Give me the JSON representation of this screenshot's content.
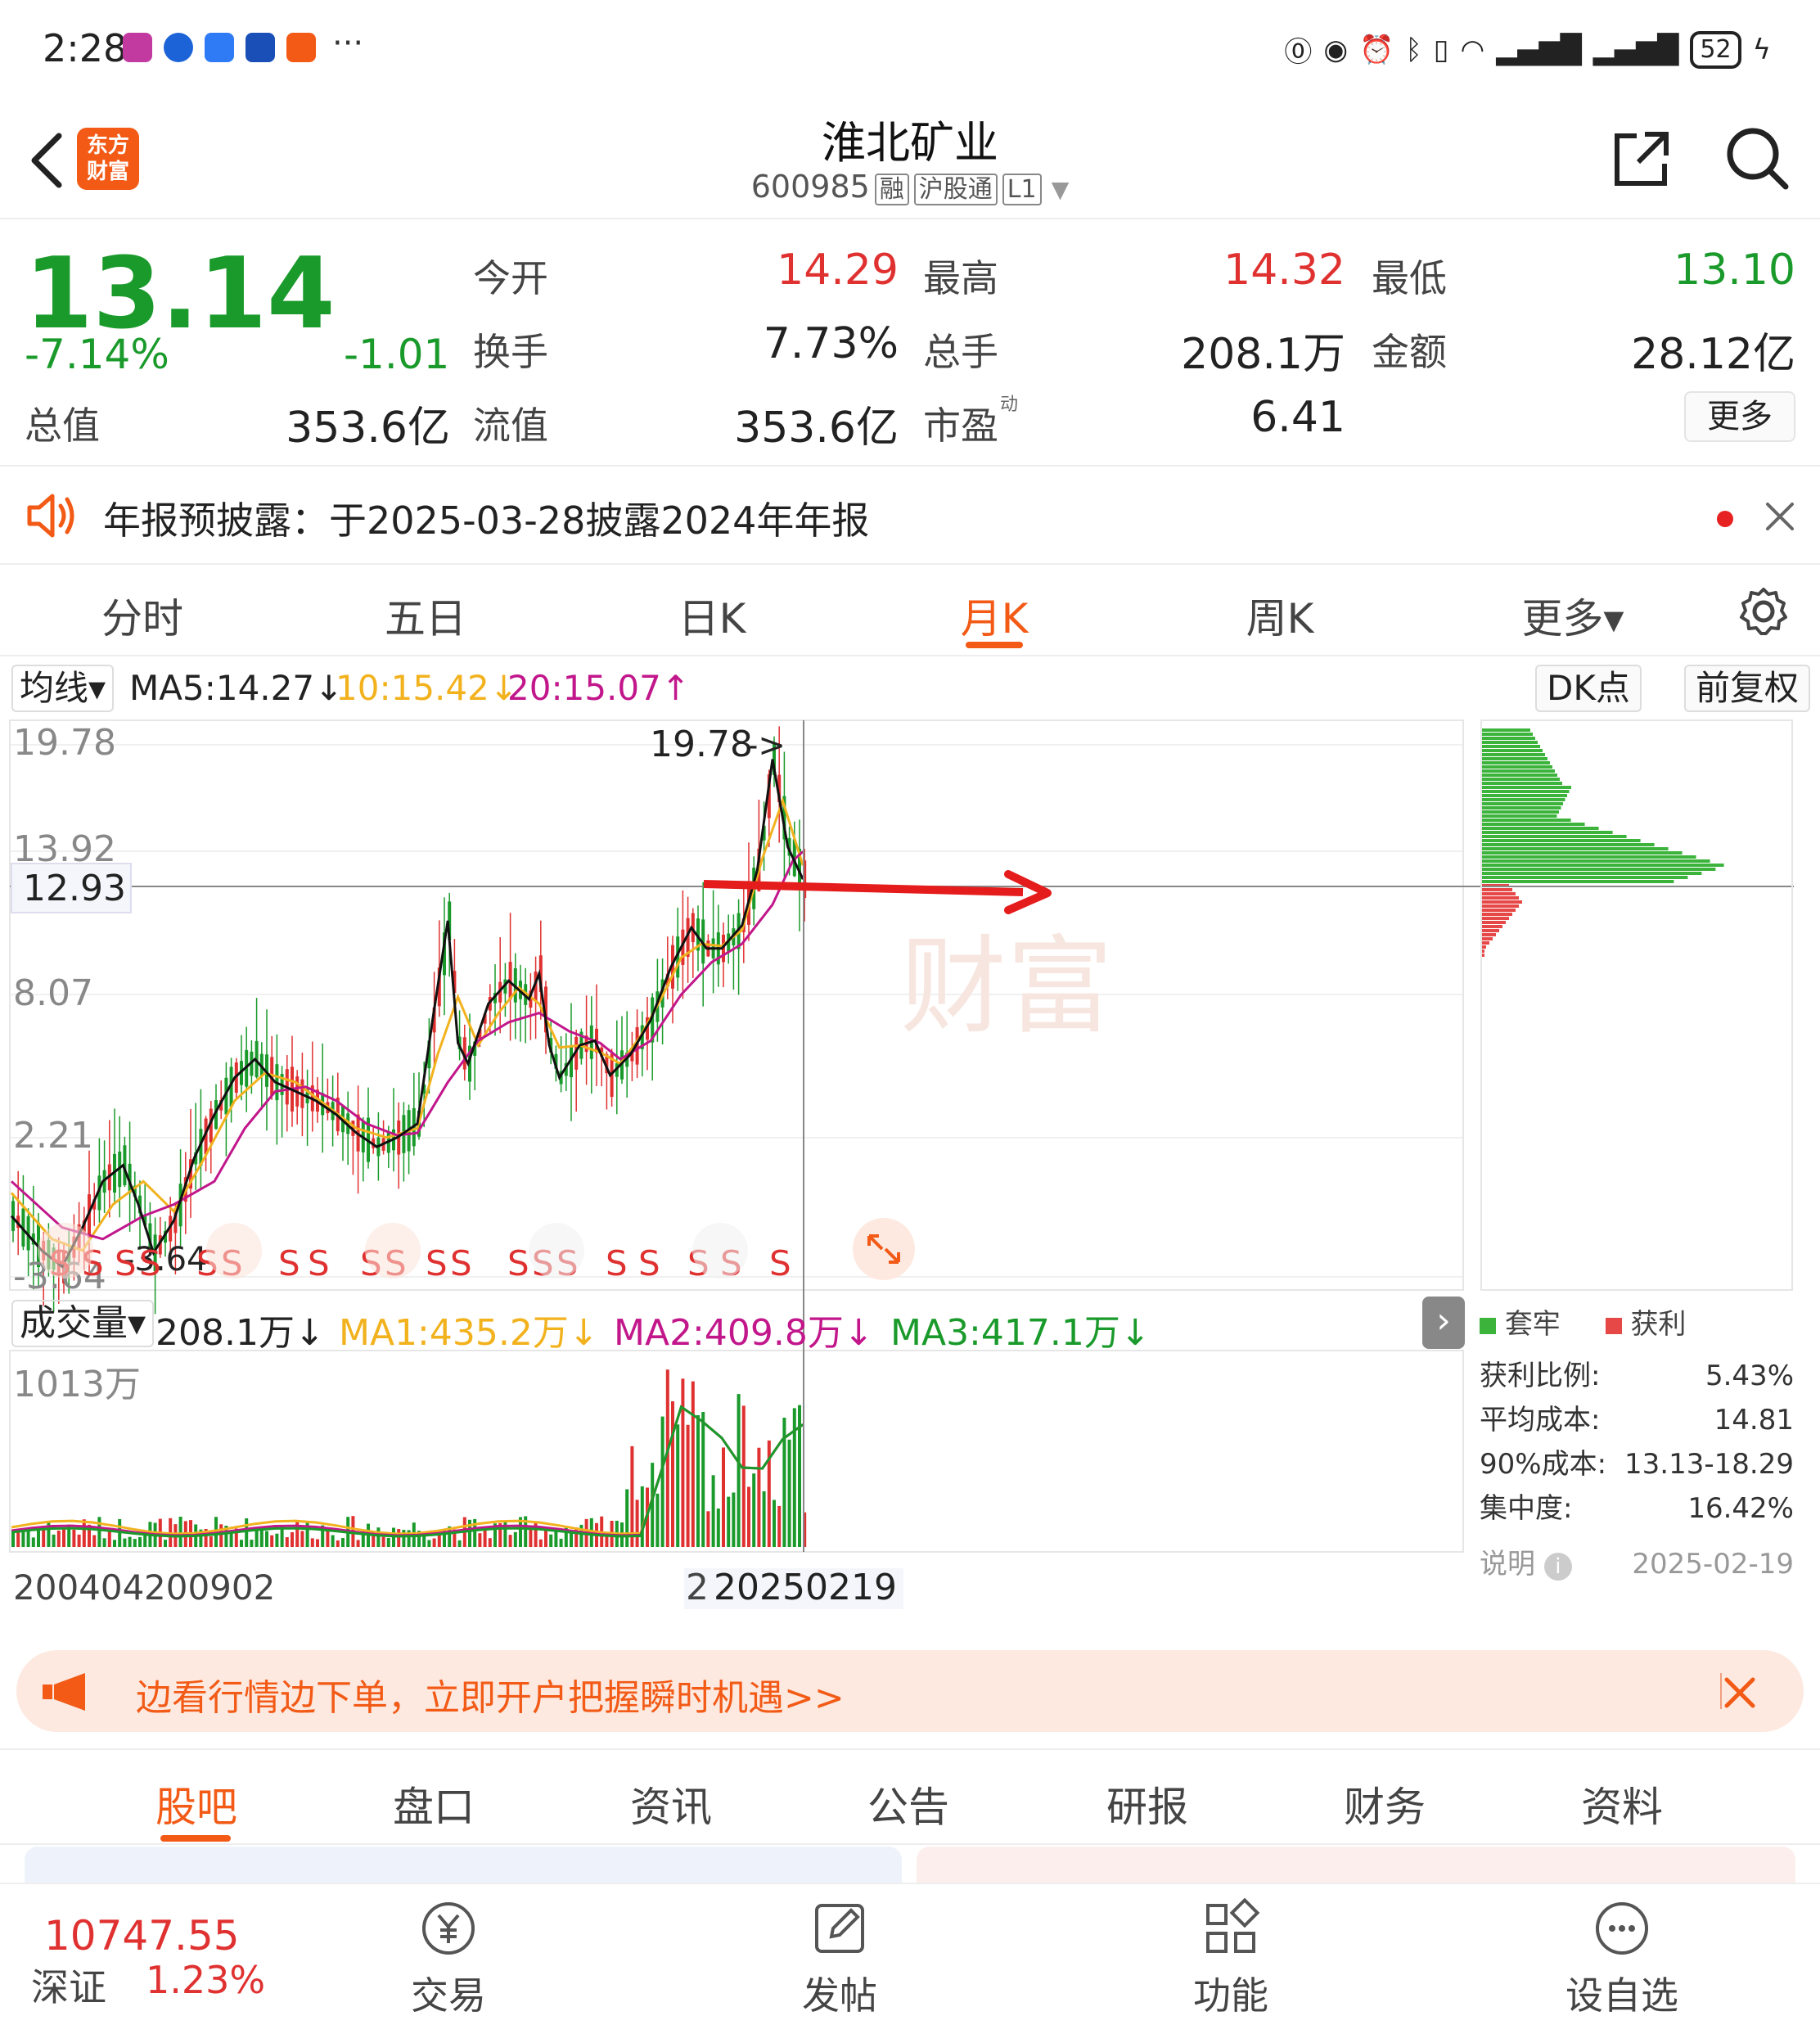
{
  "status_bar": {
    "time": "2:28",
    "more": "···",
    "battery": "52"
  },
  "header": {
    "logo_line1": "东方",
    "logo_line2": "财富",
    "title": "淮北矿业",
    "code": "600985",
    "tags": [
      "融",
      "沪股通",
      "L1"
    ]
  },
  "quote": {
    "price": "13.14",
    "change_pct": "-7.14%",
    "change_amt": "-1.01",
    "rows": [
      {
        "l1": "今开",
        "v1": "14.29",
        "l2": "最高",
        "v2": "14.32",
        "l3": "最低",
        "v3": "13.10"
      },
      {
        "l1": "换手",
        "v1": "7.73%",
        "l2": "总手",
        "v2": "208.1万",
        "l3": "金额",
        "v3": "28.12亿"
      }
    ],
    "zongzhi_label": "总值",
    "zongzhi_value": "353.6亿",
    "liuzhi_label": "流值",
    "liuzhi_value": "353.6亿",
    "pe_label": "市盈",
    "pe_super": "动",
    "pe_value": "6.41",
    "more_button": "更多"
  },
  "notice": {
    "text": "年报预披露：于2025-03-28披露2024年年报"
  },
  "chart_tabs": {
    "items": [
      "分时",
      "五日",
      "日K",
      "月K",
      "周K",
      "更多▾"
    ],
    "active_index": 3
  },
  "ma_row": {
    "dropdown": "均线▾",
    "ma5": "MA5:14.27↓",
    "ma10": "10:15.42↓",
    "ma20": "20:15.07↑",
    "dk_button": "DK点",
    "fq_button": "前复权"
  },
  "colors": {
    "up": "#e03131",
    "down": "#1a9a2b",
    "accent": "#f25a16",
    "ma5": "#111111",
    "ma10": "#f2b21e",
    "ma20": "#c2168b"
  },
  "chart_data": {
    "type": "candlestick",
    "y_axis_labels": [
      "19.78",
      "13.92",
      "8.07",
      "2.21",
      "-3.64"
    ],
    "crosshair_value": "12.93",
    "high_label": "19.78",
    "low_label": "-3.64",
    "signal_label": "S",
    "ylim": [
      -3.64,
      19.78
    ],
    "ma5_path": [
      [
        0,
        -1.0
      ],
      [
        6,
        -2.5
      ],
      [
        10,
        -3.2
      ],
      [
        14,
        -1.5
      ],
      [
        18,
        0.5
      ],
      [
        22,
        1.2
      ],
      [
        25,
        -0.5
      ],
      [
        28,
        -2.6
      ],
      [
        32,
        -1.2
      ],
      [
        36,
        1.5
      ],
      [
        40,
        3.4
      ],
      [
        44,
        5.0
      ],
      [
        48,
        5.8
      ],
      [
        52,
        4.8
      ],
      [
        56,
        4.4
      ],
      [
        60,
        4.0
      ],
      [
        64,
        3.4
      ],
      [
        68,
        2.6
      ],
      [
        72,
        2.0
      ],
      [
        76,
        2.4
      ],
      [
        80,
        3.0
      ],
      [
        83,
        7.5
      ],
      [
        86,
        11.8
      ],
      [
        88,
        6.5
      ],
      [
        90,
        5.6
      ],
      [
        94,
        8.2
      ],
      [
        98,
        9.2
      ],
      [
        102,
        8.4
      ],
      [
        104,
        9.5
      ],
      [
        106,
        6.4
      ],
      [
        108,
        5.0
      ],
      [
        112,
        6.4
      ],
      [
        115,
        6.6
      ],
      [
        118,
        5.1
      ],
      [
        122,
        6.0
      ],
      [
        126,
        7.5
      ],
      [
        130,
        9.8
      ],
      [
        134,
        11.5
      ],
      [
        137,
        10.6
      ],
      [
        140,
        10.6
      ],
      [
        144,
        11.6
      ],
      [
        147,
        14.0
      ],
      [
        150,
        18.8
      ],
      [
        153,
        15.0
      ],
      [
        156,
        13.6
      ]
    ],
    "ma10_path": [
      [
        0,
        0.0
      ],
      [
        8,
        -2.0
      ],
      [
        14,
        -2.5
      ],
      [
        20,
        -0.5
      ],
      [
        26,
        0.5
      ],
      [
        32,
        -0.8
      ],
      [
        38,
        1.5
      ],
      [
        44,
        4.0
      ],
      [
        50,
        5.2
      ],
      [
        56,
        4.8
      ],
      [
        62,
        3.8
      ],
      [
        68,
        2.8
      ],
      [
        74,
        2.4
      ],
      [
        80,
        2.8
      ],
      [
        84,
        6.0
      ],
      [
        88,
        8.5
      ],
      [
        92,
        6.4
      ],
      [
        96,
        7.8
      ],
      [
        100,
        8.9
      ],
      [
        104,
        8.2
      ],
      [
        108,
        6.3
      ],
      [
        112,
        6.4
      ],
      [
        116,
        6.1
      ],
      [
        120,
        5.6
      ],
      [
        124,
        6.8
      ],
      [
        128,
        8.4
      ],
      [
        132,
        10.2
      ],
      [
        136,
        10.8
      ],
      [
        140,
        10.7
      ],
      [
        144,
        11.4
      ],
      [
        148,
        14.5
      ],
      [
        152,
        17.0
      ],
      [
        156,
        14.2
      ]
    ],
    "ma20_path": [
      [
        0,
        0.5
      ],
      [
        10,
        -1.5
      ],
      [
        18,
        -2.0
      ],
      [
        26,
        -1.0
      ],
      [
        32,
        -0.5
      ],
      [
        40,
        0.5
      ],
      [
        46,
        2.8
      ],
      [
        52,
        4.4
      ],
      [
        58,
        4.6
      ],
      [
        64,
        4.0
      ],
      [
        70,
        3.0
      ],
      [
        76,
        2.5
      ],
      [
        80,
        2.6
      ],
      [
        86,
        4.8
      ],
      [
        92,
        6.6
      ],
      [
        98,
        7.4
      ],
      [
        104,
        7.8
      ],
      [
        110,
        7.0
      ],
      [
        116,
        6.5
      ],
      [
        120,
        5.8
      ],
      [
        126,
        6.6
      ],
      [
        132,
        8.6
      ],
      [
        138,
        10.0
      ],
      [
        144,
        10.8
      ],
      [
        150,
        12.5
      ],
      [
        154,
        14.4
      ],
      [
        156,
        14.8
      ]
    ],
    "chip_distribution": {
      "legend": [
        "套牢",
        "获利"
      ]
    },
    "volume": {
      "dropdown": "成交量▾",
      "current": "208.1万↓",
      "ma1": "MA1:435.2万↓",
      "ma2": "MA2:409.8万↓",
      "ma3": "MA3:417.1万↓",
      "y_max_label": "1013万"
    },
    "x_axis_labels": [
      "200404",
      "200902",
      "2",
      "20250219"
    ]
  },
  "chip_stats": {
    "items": [
      {
        "label": "获利比例:",
        "value": "5.43%"
      },
      {
        "label": "平均成本:",
        "value": "14.81"
      },
      {
        "label": "90%成本:",
        "value": "13.13-18.29"
      },
      {
        "label": "集中度:",
        "value": "16.42%"
      }
    ],
    "footer_label": "说明",
    "footer_date": "2025-02-19"
  },
  "promo": {
    "text": "边看行情边下单，立即开户把握瞬时机遇>>"
  },
  "info_tabs": {
    "items": [
      "股吧",
      "盘口",
      "资讯",
      "公告",
      "研报",
      "财务",
      "资料"
    ],
    "active_index": 0
  },
  "bottom_nav": {
    "index_value": "10747.55",
    "index_name": "深证",
    "index_pct": "1.23%",
    "items": [
      "交易",
      "发帖",
      "功能",
      "设自选"
    ]
  }
}
